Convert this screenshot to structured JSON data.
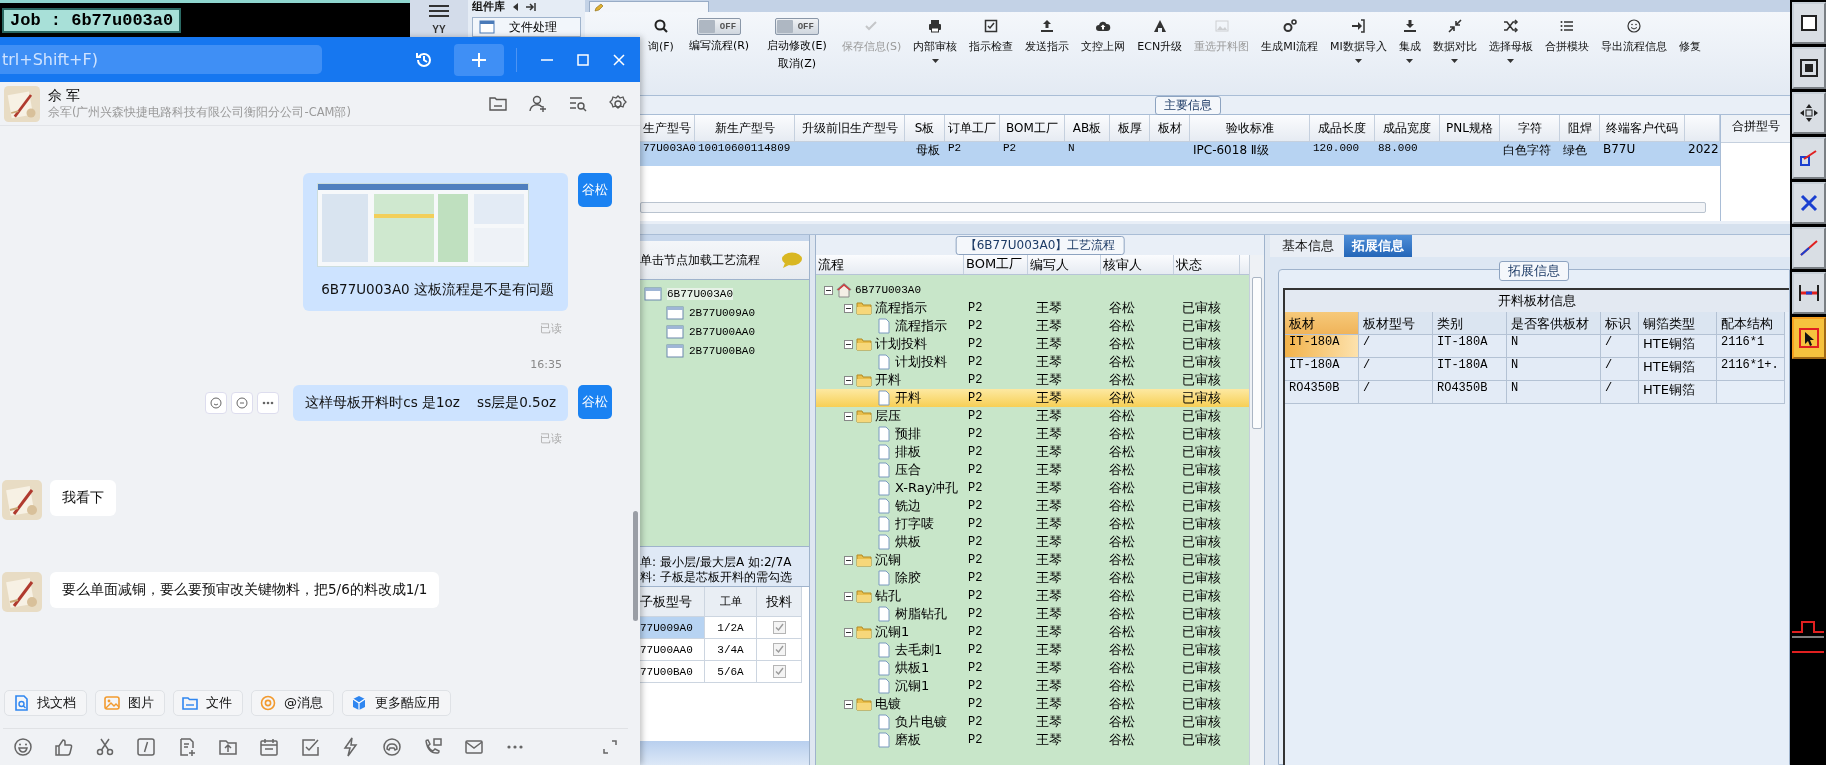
{
  "cam_panel": {
    "job_label": "Job : 6b77u003a0"
  },
  "side_nav": {
    "badge": "YY",
    "tab": "组件库",
    "button": "文件处理"
  },
  "main": {
    "toolbar": {
      "items": [
        {
          "kind": "button",
          "label": "询(F)",
          "disabled": false,
          "dropdown": false
        },
        {
          "kind": "toggle",
          "switch_text": "OFF",
          "on": false,
          "label": "编写流程(R)"
        },
        {
          "kind": "toggle",
          "switch_text": "OFF",
          "on": false,
          "label": "启动修改(E)",
          "label_2": "取消(Z)"
        },
        {
          "kind": "button",
          "label": "保存信息(S)",
          "disabled": true,
          "dropdown": false
        },
        {
          "kind": "button",
          "label": "内部审核",
          "disabled": false,
          "dropdown": true
        },
        {
          "kind": "button",
          "label": "指示检查",
          "disabled": false,
          "dropdown": false
        },
        {
          "kind": "button",
          "label": "发送指示",
          "disabled": false,
          "dropdown": false
        },
        {
          "kind": "button",
          "label": "文控上网",
          "disabled": false,
          "dropdown": false
        },
        {
          "kind": "button",
          "label": "ECN升级",
          "disabled": false,
          "dropdown": false
        },
        {
          "kind": "button",
          "label": "重选开料图",
          "disabled": true,
          "dropdown": false
        },
        {
          "kind": "button",
          "label": "生成MI流程",
          "disabled": false,
          "dropdown": false
        },
        {
          "kind": "button",
          "label": "MI数据导入",
          "disabled": false,
          "dropdown": true
        },
        {
          "kind": "button",
          "label": "集成",
          "disabled": false,
          "dropdown": true
        },
        {
          "kind": "button",
          "label": "数据对比",
          "disabled": false,
          "dropdown": true
        },
        {
          "kind": "button",
          "label": "选择母板",
          "disabled": false,
          "dropdown": true
        },
        {
          "kind": "button",
          "label": "合拼模块",
          "disabled": false,
          "dropdown": false
        },
        {
          "kind": "button",
          "label": "导出流程信息",
          "disabled": false,
          "dropdown": false
        },
        {
          "kind": "button",
          "label": "修复",
          "disabled": false,
          "dropdown": false
        }
      ]
    },
    "main_info": {
      "title": "主要信息",
      "side_header": "合拼型号",
      "columns": [
        "生产型号",
        "新生产型号",
        "升级前旧生产型号",
        "S板",
        "订单工厂",
        "BOM工厂",
        "AB板",
        "板厚",
        "板材",
        "验收标准",
        "成品长度",
        "成品宽度",
        "PNL规格",
        "字符",
        "阻焊",
        "终端客户代码"
      ],
      "rows": [
        {
          "selected": true,
          "cells": [
            "77U003A0",
            "10010600114809",
            null,
            "母板",
            "P2",
            "P2",
            "N",
            null,
            null,
            "IPC-6018 Ⅱ级",
            "120.000",
            "88.000",
            null,
            "白色字符",
            "绿色",
            "B77U",
            "2022"
          ]
        }
      ]
    },
    "flow_loader": {
      "hint": "单击节点加载工艺流程",
      "tree": {
        "label": "6B77U003A0",
        "selected": true,
        "children": [
          {
            "label": "2B77U009A0",
            "selected": false
          },
          {
            "label": "2B77U00AA0",
            "selected": false
          },
          {
            "label": "2B77U00BA0",
            "selected": false
          }
        ]
      },
      "notes": [
        "单: 最小层/最大层A 如:2/7A",
        "料: 子板是芯板开料的需勾选"
      ],
      "subboards": {
        "columns": [
          "子板型号",
          "工单",
          "投料"
        ],
        "rows": [
          {
            "cells": [
              "77U009A0",
              "1/2A"
            ],
            "checked": true,
            "selected": true
          },
          {
            "cells": [
              "77U00AA0",
              "3/4A"
            ],
            "checked": true,
            "selected": false
          },
          {
            "cells": [
              "77U00BA0",
              "5/6A"
            ],
            "checked": true,
            "selected": false
          }
        ]
      }
    },
    "process": {
      "title": "【6B77U003A0】工艺流程",
      "columns": [
        "流程",
        "BOM工厂",
        "编写人",
        "核审人",
        "状态"
      ],
      "tree": {
        "kind": "root",
        "label": "6B77U003A0",
        "expanded": true,
        "selected": false,
        "children": [
          {
            "kind": "group",
            "label": "流程指示",
            "bom": "P2",
            "writer": "王琴",
            "reviewer": "谷松",
            "status": "已审核",
            "expanded": true,
            "selected": false,
            "children": [
              {
                "kind": "step",
                "label": "流程指示",
                "bom": "P2",
                "writer": "王琴",
                "reviewer": "谷松",
                "status": "已审核",
                "selected": false
              }
            ]
          },
          {
            "kind": "group",
            "label": "计划投料",
            "bom": "P2",
            "writer": "王琴",
            "reviewer": "谷松",
            "status": "已审核",
            "expanded": true,
            "selected": false,
            "children": [
              {
                "kind": "step",
                "label": "计划投料",
                "bom": "P2",
                "writer": "王琴",
                "reviewer": "谷松",
                "status": "已审核",
                "selected": false
              }
            ]
          },
          {
            "kind": "group",
            "label": "开料",
            "bom": "P2",
            "writer": "王琴",
            "reviewer": "谷松",
            "status": "已审核",
            "expanded": true,
            "selected": false,
            "children": [
              {
                "kind": "step",
                "label": "开料",
                "bom": "P2",
                "writer": "王琴",
                "reviewer": "谷松",
                "status": "已审核",
                "selected": true
              }
            ]
          },
          {
            "kind": "group",
            "label": "层压",
            "bom": "P2",
            "writer": "王琴",
            "reviewer": "谷松",
            "status": "已审核",
            "expanded": true,
            "selected": false,
            "children": [
              {
                "kind": "step",
                "label": "预排",
                "bom": "P2",
                "writer": "王琴",
                "reviewer": "谷松",
                "status": "已审核",
                "selected": false
              },
              {
                "kind": "step",
                "label": "排板",
                "bom": "P2",
                "writer": "王琴",
                "reviewer": "谷松",
                "status": "已审核",
                "selected": false
              },
              {
                "kind": "step",
                "label": "压合",
                "bom": "P2",
                "writer": "王琴",
                "reviewer": "谷松",
                "status": "已审核",
                "selected": false
              },
              {
                "kind": "step",
                "label": "X-Ray冲孔",
                "bom": "P2",
                "writer": "王琴",
                "reviewer": "谷松",
                "status": "已审核",
                "selected": false
              },
              {
                "kind": "step",
                "label": "铣边",
                "bom": "P2",
                "writer": "王琴",
                "reviewer": "谷松",
                "status": "已审核",
                "selected": false
              },
              {
                "kind": "step",
                "label": "打字唛",
                "bom": "P2",
                "writer": "王琴",
                "reviewer": "谷松",
                "status": "已审核",
                "selected": false
              },
              {
                "kind": "step",
                "label": "烘板",
                "bom": "P2",
                "writer": "王琴",
                "reviewer": "谷松",
                "status": "已审核",
                "selected": false
              }
            ]
          },
          {
            "kind": "group",
            "label": "沉铜",
            "bom": "P2",
            "writer": "王琴",
            "reviewer": "谷松",
            "status": "已审核",
            "expanded": true,
            "selected": false,
            "children": [
              {
                "kind": "step",
                "label": "除胶",
                "bom": "P2",
                "writer": "王琴",
                "reviewer": "谷松",
                "status": "已审核",
                "selected": false
              }
            ]
          },
          {
            "kind": "group",
            "label": "钻孔",
            "bom": "P2",
            "writer": "王琴",
            "reviewer": "谷松",
            "status": "已审核",
            "expanded": true,
            "selected": false,
            "children": [
              {
                "kind": "step",
                "label": "树脂钻孔",
                "bom": "P2",
                "writer": "王琴",
                "reviewer": "谷松",
                "status": "已审核",
                "selected": false
              }
            ]
          },
          {
            "kind": "group",
            "label": "沉铜1",
            "bom": "P2",
            "writer": "王琴",
            "reviewer": "谷松",
            "status": "已审核",
            "expanded": true,
            "selected": false,
            "children": [
              {
                "kind": "step",
                "label": "去毛刺1",
                "bom": "P2",
                "writer": "王琴",
                "reviewer": "谷松",
                "status": "已审核",
                "selected": false
              },
              {
                "kind": "step",
                "label": "烘板1",
                "bom": "P2",
                "writer": "王琴",
                "reviewer": "谷松",
                "status": "已审核",
                "selected": false
              },
              {
                "kind": "step",
                "label": "沉铜1",
                "bom": "P2",
                "writer": "王琴",
                "reviewer": "谷松",
                "status": "已审核",
                "selected": false
              }
            ]
          },
          {
            "kind": "group",
            "label": "电镀",
            "bom": "P2",
            "writer": "王琴",
            "reviewer": "谷松",
            "status": "已审核",
            "expanded": true,
            "selected": false,
            "children": [
              {
                "kind": "step",
                "label": "负片电镀",
                "bom": "P2",
                "writer": "王琴",
                "reviewer": "谷松",
                "status": "已审核",
                "selected": false
              },
              {
                "kind": "step",
                "label": "磨板",
                "bom": "P2",
                "writer": "王琴",
                "reviewer": "谷松",
                "status": "已审核",
                "selected": false
              }
            ]
          }
        ]
      }
    },
    "extended": {
      "tabs": [
        {
          "label": "基本信息",
          "selected": false
        },
        {
          "label": "拓展信息",
          "selected": true
        }
      ],
      "legend": "拓展信息",
      "table_title": "开料板材信息",
      "columns": [
        "板材",
        "板材型号",
        "类别",
        "是否客供板材",
        "标识",
        "铜箔类型",
        "配本结构"
      ],
      "rows": [
        {
          "selected": true,
          "cells": [
            "IT-180A",
            "/",
            "IT-180A",
            "N",
            "/",
            "HTE铜箔",
            "2116*1"
          ]
        },
        {
          "selected": false,
          "cells": [
            "IT-180A",
            "/",
            "IT-180A",
            "N",
            "/",
            "HTE铜箔",
            "2116*1+."
          ]
        },
        {
          "selected": false,
          "cells": [
            "RO4350B",
            "/",
            "RO4350B",
            "N",
            "/",
            "HTE铜箔",
            null
          ]
        }
      ]
    }
  },
  "tool_strip": {
    "tools": [
      {
        "selected": false
      },
      {
        "selected": false
      },
      {
        "selected": false
      },
      {
        "selected": false
      },
      {
        "selected": false
      },
      {
        "selected": false
      },
      {
        "selected": false
      },
      {
        "selected": true
      }
    ]
  },
  "chat": {
    "search_placeholder": "trl+Shift+F)",
    "contact": {
      "name": "佘 军",
      "subtitle": "佘军(广州兴森快捷电路科技有限公司衡阳分公司-CAM部)"
    },
    "messages": [
      {
        "kind": "outgoing_image",
        "sender": "谷松",
        "text": "6B77U003A0 这板流程是不是有问题",
        "receipt": "已读"
      },
      {
        "kind": "time",
        "text": "16:35"
      },
      {
        "kind": "outgoing",
        "sender": "谷松",
        "text": "这样母板开料时cs 是1oz    ss层是0.5oz",
        "receipt": "已读"
      },
      {
        "kind": "incoming",
        "text": "我看下"
      },
      {
        "kind": "incoming",
        "text": "要么单面减铜，要么要预审改关键物料，把5/6的料改成1/1"
      }
    ],
    "quick_actions": [
      "找文档",
      "图片",
      "文件",
      "@消息",
      "更多酷应用"
    ]
  }
}
